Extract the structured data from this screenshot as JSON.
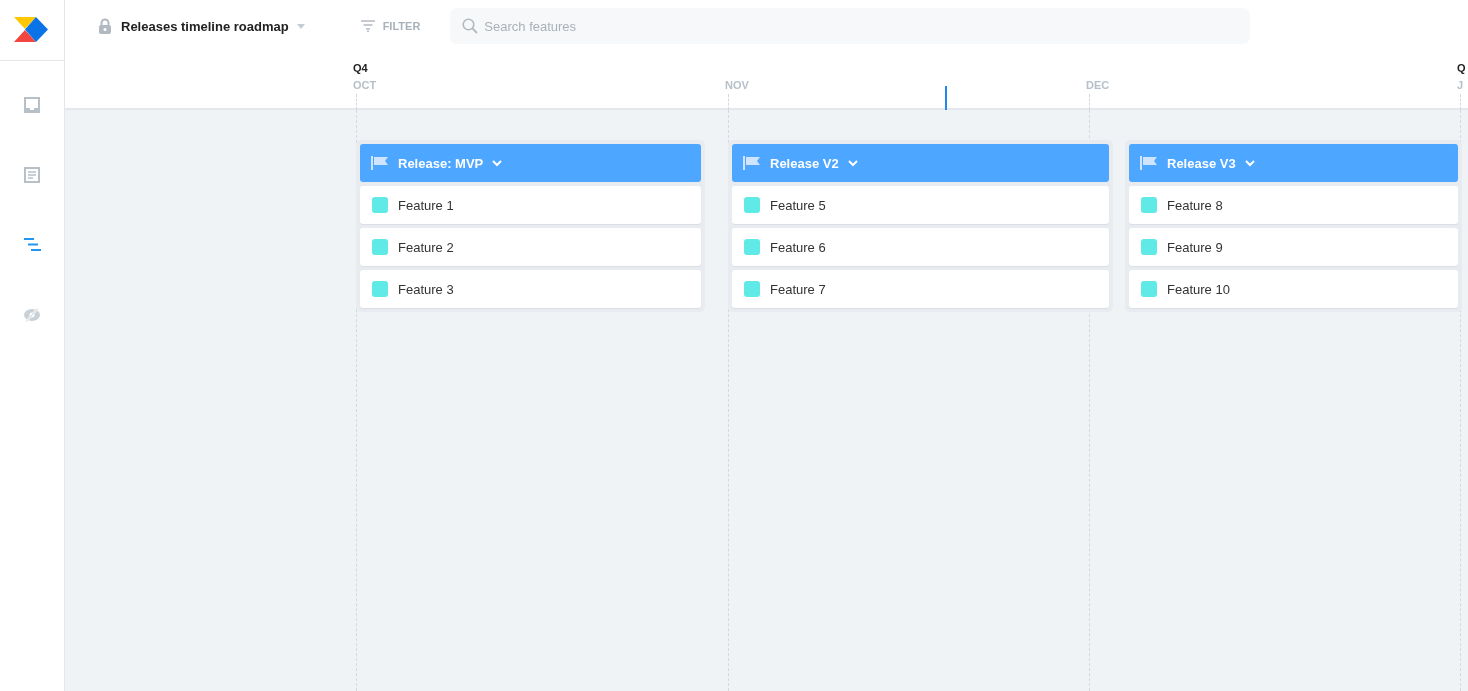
{
  "topbar": {
    "board_title": "Releases timeline roadmap",
    "filter_label": "FILTER",
    "search": {
      "placeholder": "Search features"
    }
  },
  "sidebar": {
    "items": [
      {
        "kind": "inbox",
        "selected": false
      },
      {
        "kind": "document",
        "selected": false
      },
      {
        "kind": "roadmap",
        "selected": true
      },
      {
        "kind": "hidden",
        "selected": false
      }
    ]
  },
  "timeline": {
    "months": [
      {
        "label": "OCT",
        "quarter": "Q4"
      },
      {
        "label": "NOV"
      },
      {
        "label": "DEC"
      },
      {
        "label": "J",
        "quarter": "Q"
      }
    ],
    "releases": [
      {
        "name": "Release: MVP",
        "features": [
          "Feature 1",
          "Feature 2",
          "Feature 3"
        ]
      },
      {
        "name": "Release V2",
        "features": [
          "Feature 5",
          "Feature 6",
          "Feature 7"
        ]
      },
      {
        "name": "Release V3",
        "features": [
          "Feature 8",
          "Feature 9",
          "Feature 10"
        ]
      }
    ]
  }
}
